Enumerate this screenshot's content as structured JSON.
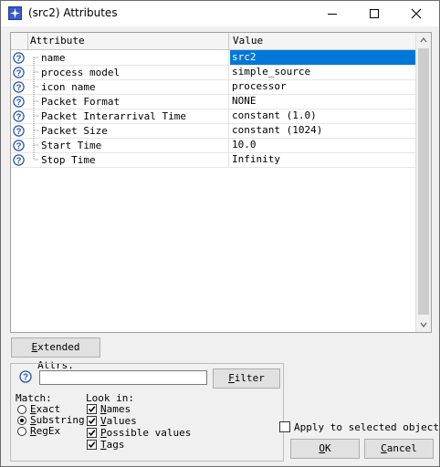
{
  "window": {
    "title": "(src2) Attributes"
  },
  "table": {
    "headers": {
      "attribute": "Attribute",
      "value": "Value"
    },
    "rows": [
      {
        "attribute": "name",
        "value": "src2",
        "selected": true
      },
      {
        "attribute": "process model",
        "value": "simple_source"
      },
      {
        "attribute": "icon name",
        "value": "processor"
      },
      {
        "attribute": "Packet Format",
        "value": "NONE"
      },
      {
        "attribute": "Packet Interarrival Time",
        "value": "constant (1.0)"
      },
      {
        "attribute": "Packet Size",
        "value": "constant (1024)"
      },
      {
        "attribute": "Start Time",
        "value": "10.0"
      },
      {
        "attribute": "Stop Time",
        "value": "Infinity"
      }
    ]
  },
  "buttons": {
    "extended_pre": "E",
    "extended_post": "xtended Attrs.",
    "filter_pre": "",
    "filter_u": "F",
    "filter_post": "ilter",
    "ok_u": "O",
    "ok_post": "K",
    "cancel_u": "C",
    "cancel_post": "ancel"
  },
  "filter": {
    "search_value": "",
    "match_label": "Match:",
    "match_options": [
      {
        "u": "E",
        "rest": "xact",
        "checked": false
      },
      {
        "u": "S",
        "rest": "ubstring",
        "checked": true
      },
      {
        "u": "R",
        "rest": "egEx",
        "checked": false
      }
    ],
    "lookin_label": "Look in:",
    "lookin_options": [
      {
        "u": "N",
        "rest": "ames",
        "checked": true
      },
      {
        "u": "V",
        "rest": "alues",
        "checked": true
      },
      {
        "u": "P",
        "rest": "ossible values",
        "checked": true
      },
      {
        "u": "T",
        "rest": "ags",
        "checked": true
      }
    ]
  },
  "apply_to_selected": {
    "label": "Apply to selected objects",
    "checked": false
  },
  "colors": {
    "selection": "#0078d7",
    "help_icon": "#1f4fb0"
  }
}
